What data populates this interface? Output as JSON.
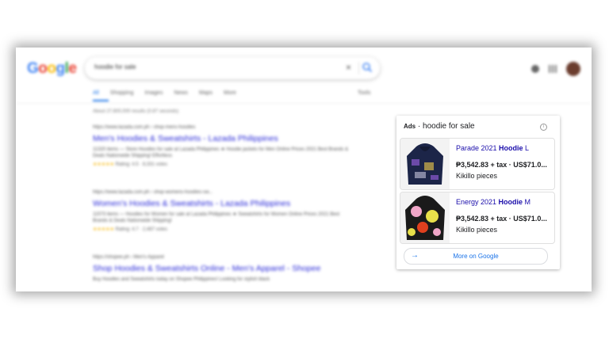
{
  "search": {
    "query": "hoodie for sale"
  },
  "tabs": [
    "All",
    "Shopping",
    "Images",
    "News",
    "Maps",
    "More"
  ],
  "tools_label": "Tools",
  "stats": "About 27,600,000 results (0.87 seconds)",
  "results": [
    {
      "cite": "https://www.lazada.com.ph › shop-mens-hoodies",
      "title": "Men's Hoodies & Sweatshirts - Lazada Philippines",
      "snippet": "11320 items — Store Hoodies for sale at Lazada Philippines ★ Hoodie jackets for Men Online Prices 2021 Best Brands & Deals Nationwide Shipping! Effortless",
      "rating": "Rating: 4.5 · 8,331 votes"
    },
    {
      "cite": "https://www.lazada.com.ph › shop-womens-hoodies-sw...",
      "title": "Women's Hoodies & Sweatshirts - Lazada Philippines",
      "snippet": "11573 items — Hoodies for Women for sale at Lazada Philippines ★ Sweatshirts for Women Online Prices 2021 Best Brands & Deals Nationwide Shipping!",
      "rating": "Rating: 4.7 · 2,487 votes"
    },
    {
      "cite": "https://shopee.ph › Men's-Apparel",
      "title": "Shop Hoodies & Sweatshirts Online - Men's Apparel - Shopee",
      "snippet": "Buy Hoodies and Sweatshirts today on Shopee Philippines! Looking for stylish black",
      "rating": ""
    }
  ],
  "ads": {
    "badge": "Ads",
    "sep": " · ",
    "query": "hoodie for sale",
    "items": [
      {
        "name_pre": "Parade 2021 ",
        "name_bold": "Hoodie",
        "name_post": " L",
        "price": "₱3,542.83 + tax · US$71.0...",
        "seller": "Kikillo pieces",
        "colors": [
          "#1c2548",
          "#6b4aa8",
          "#d7b84a",
          "#c8c8e0"
        ]
      },
      {
        "name_pre": "Energy 2021 ",
        "name_bold": "Hoodie",
        "name_post": " M",
        "price": "₱3,542.83 + tax · US$71.0...",
        "seller": "Kikillo pieces",
        "colors": [
          "#1a1a1a",
          "#f0a6c8",
          "#e8e04a",
          "#e0401e"
        ]
      }
    ],
    "more_label": "More on Google"
  },
  "icons": {
    "info": "info-icon",
    "arrow": "arrow-right-icon",
    "search": "search-icon"
  }
}
